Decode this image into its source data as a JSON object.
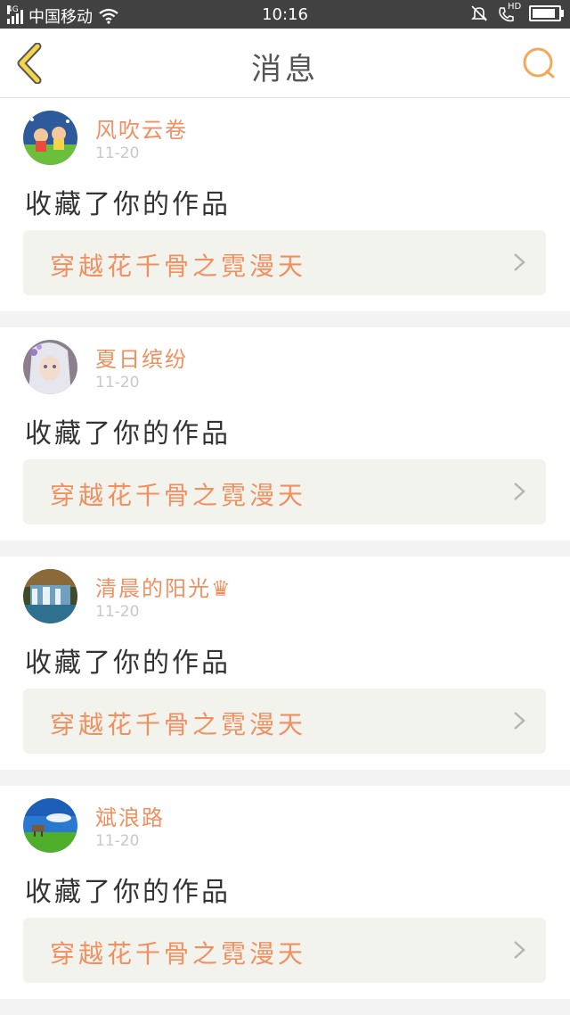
{
  "status_bar": {
    "network": "4G",
    "carrier": "中国移动",
    "time": "10:16",
    "hd": "HD",
    "battery_level": 0.9
  },
  "header": {
    "title": "消息",
    "back_icon": "back-chevron-icon",
    "search_icon": "search-icon",
    "accent_color": "#f4a85a"
  },
  "messages": [
    {
      "username": "风吹云卷",
      "date": "11-20",
      "action": "收藏了你的作品",
      "work_title": "穿越花千骨之霓漫天",
      "avatar": "cartoon-kids"
    },
    {
      "username": "夏日缤纷",
      "date": "11-20",
      "action": "收藏了你的作品",
      "work_title": "穿越花千骨之霓漫天",
      "avatar": "anime-girl"
    },
    {
      "username": "清晨的阳光♛",
      "date": "11-20",
      "action": "收藏了你的作品",
      "work_title": "穿越花千骨之霓漫天",
      "avatar": "waterfall"
    },
    {
      "username": "斌浪路",
      "date": "11-20",
      "action": "收藏了你的作品",
      "work_title": "穿越花千骨之霓漫天",
      "avatar": "meadow-sky"
    }
  ]
}
